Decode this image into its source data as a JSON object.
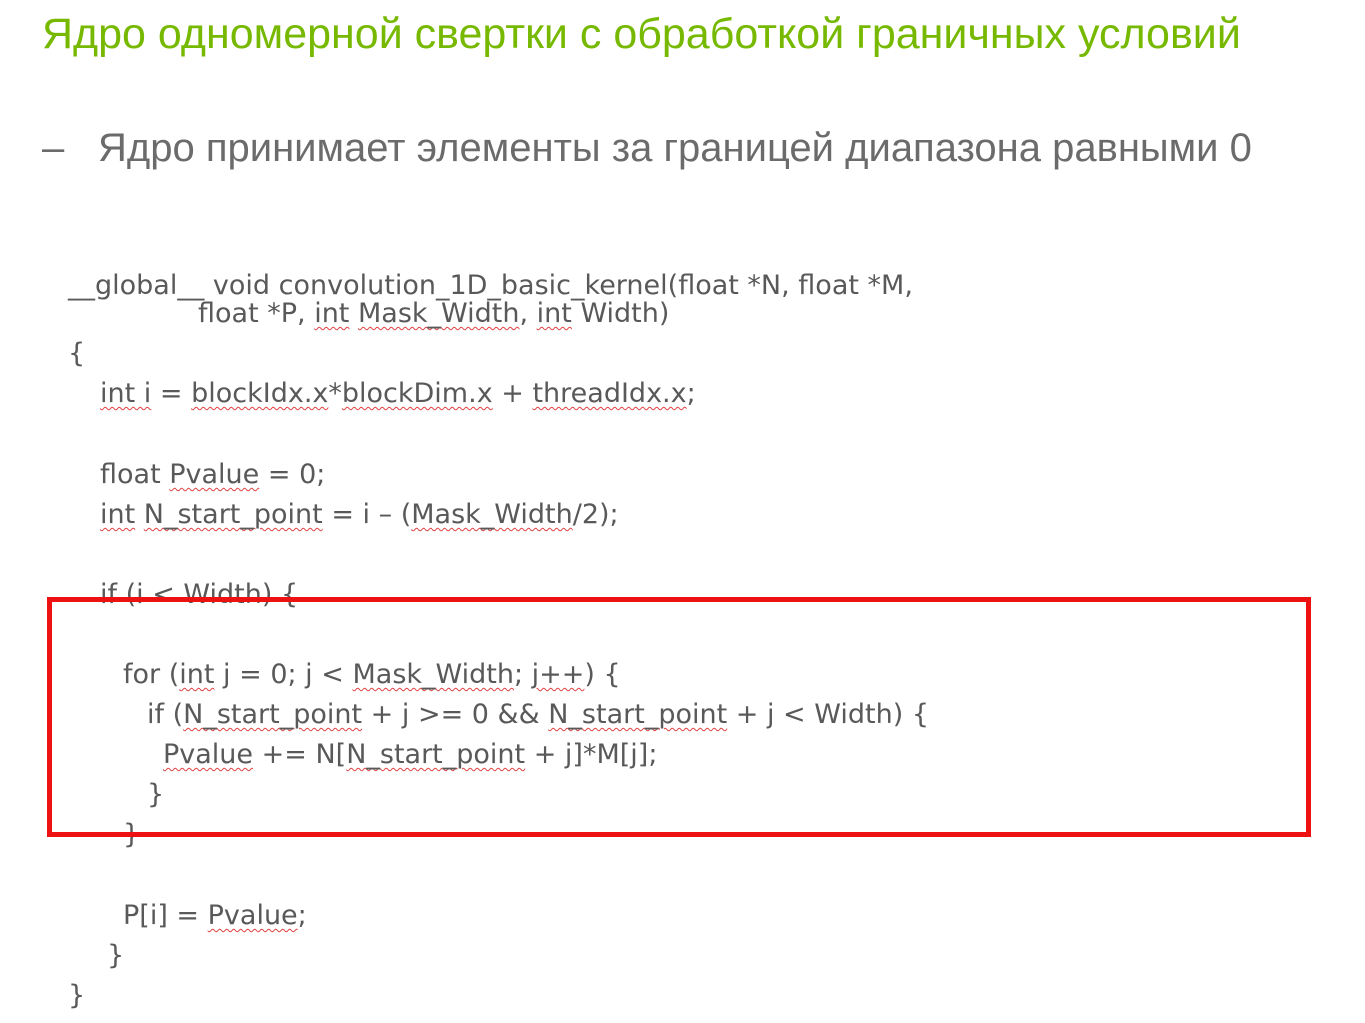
{
  "title": "Ядро одномерной свертки с обработкой граничных условий",
  "bullet": {
    "dash": "–",
    "text": "Ядро принимает элементы за границей диапазона равными 0"
  },
  "code": {
    "l1": "__global__ void convolution_1D_basic_kernel(float *N, float *M,",
    "l2_a": "float *P, ",
    "l2_b": "int",
    "l2_c": " ",
    "l2_d": "Mask_Width",
    "l2_e": ", ",
    "l2_f": "int",
    "l2_g": " Width)",
    "l3": "{",
    "l4_a": "int i",
    "l4_b": " = ",
    "l4_c": "blockIdx.x",
    "l4_d": "*",
    "l4_e": "blockDim.x",
    "l4_f": " + ",
    "l4_g": "threadIdx.x",
    "l4_h": ";",
    "l5_a": "float ",
    "l5_b": "Pvalue",
    "l5_c": " = 0;",
    "l6_a": "int",
    "l6_b": " ",
    "l6_c": "N_start_point",
    "l6_d": " = i – (",
    "l6_e": "Mask_Width",
    "l6_f": "/2);",
    "l7": "if (i < Width) {",
    "l8_a": "for (",
    "l8_b": "int",
    "l8_c": " j = 0; j < ",
    "l8_d": "Mask_Width",
    "l8_e": "; ",
    "l8_f": "j++",
    "l8_g": ") {",
    "l9_a": "if (",
    "l9_b": "N_start_point",
    "l9_c": " + j >= 0 && ",
    "l9_d": "N_start_point",
    "l9_e": " + j < Width) {",
    "l10_a": "Pvalue",
    "l10_b": " += N[",
    "l10_c": "N_start_point",
    "l10_d": " + j]*M[j];",
    "l11": "}",
    "l12": "}",
    "l13_a": "P[i] = ",
    "l13_b": "Pvalue",
    "l13_c": ";",
    "l14": "}",
    "l15": "}"
  },
  "colors": {
    "title": "#76b900",
    "bullet": "#6b6b6b",
    "code": "#595959",
    "highlight_border": "#ee1111",
    "spellcheck_underline": "#e04040"
  }
}
